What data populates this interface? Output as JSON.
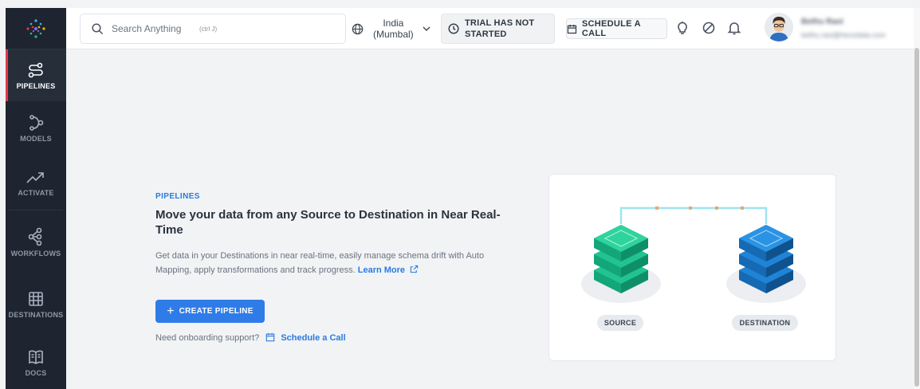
{
  "search": {
    "placeholder": "Search Anything",
    "shortcut": "(ctrl J)"
  },
  "region": {
    "line1": "India",
    "line2": "(Mumbal)"
  },
  "trial": {
    "line1": "TRIAL HAS NOT",
    "line2": "STARTED"
  },
  "header": {
    "schedule_label": "SCHEDULE A CALL"
  },
  "user": {
    "name": "Bethu Raoi",
    "email": "bethu.raoi@hevodata.com"
  },
  "sidebar": {
    "items": [
      {
        "label": "PIPELINES",
        "icon": "pipelines-icon",
        "active": true
      },
      {
        "label": "MODELS",
        "icon": "models-icon",
        "active": false
      },
      {
        "label": "ACTIVATE",
        "icon": "activate-icon",
        "active": false
      },
      {
        "label": "WORKFLOWS",
        "icon": "workflows-icon",
        "active": false
      },
      {
        "label": "DESTINATIONS",
        "icon": "destinations-icon",
        "active": false
      },
      {
        "label": "DOCS",
        "icon": "docs-icon",
        "active": false
      }
    ]
  },
  "main": {
    "section_label": "PIPELINES",
    "headline": "Move your data from any Source to Destination in Near Real-Time",
    "description": "Get data in your Destinations in near real-time, easily manage schema drift with Auto Mapping, apply transformations and track progress.",
    "learn_more": "Learn More",
    "create_button": "CREATE PIPELINE",
    "support_text": "Need onboarding support?",
    "schedule_link": "Schedule a Call"
  },
  "illustration": {
    "source_label": "SOURCE",
    "destination_label": "DESTINATION",
    "source_color": "#1bb487",
    "destination_color": "#1a78c9"
  },
  "colors": {
    "accent": "#2f7ce8",
    "sidebar_bg": "#1e2530",
    "active_indicator": "#e2384d"
  }
}
